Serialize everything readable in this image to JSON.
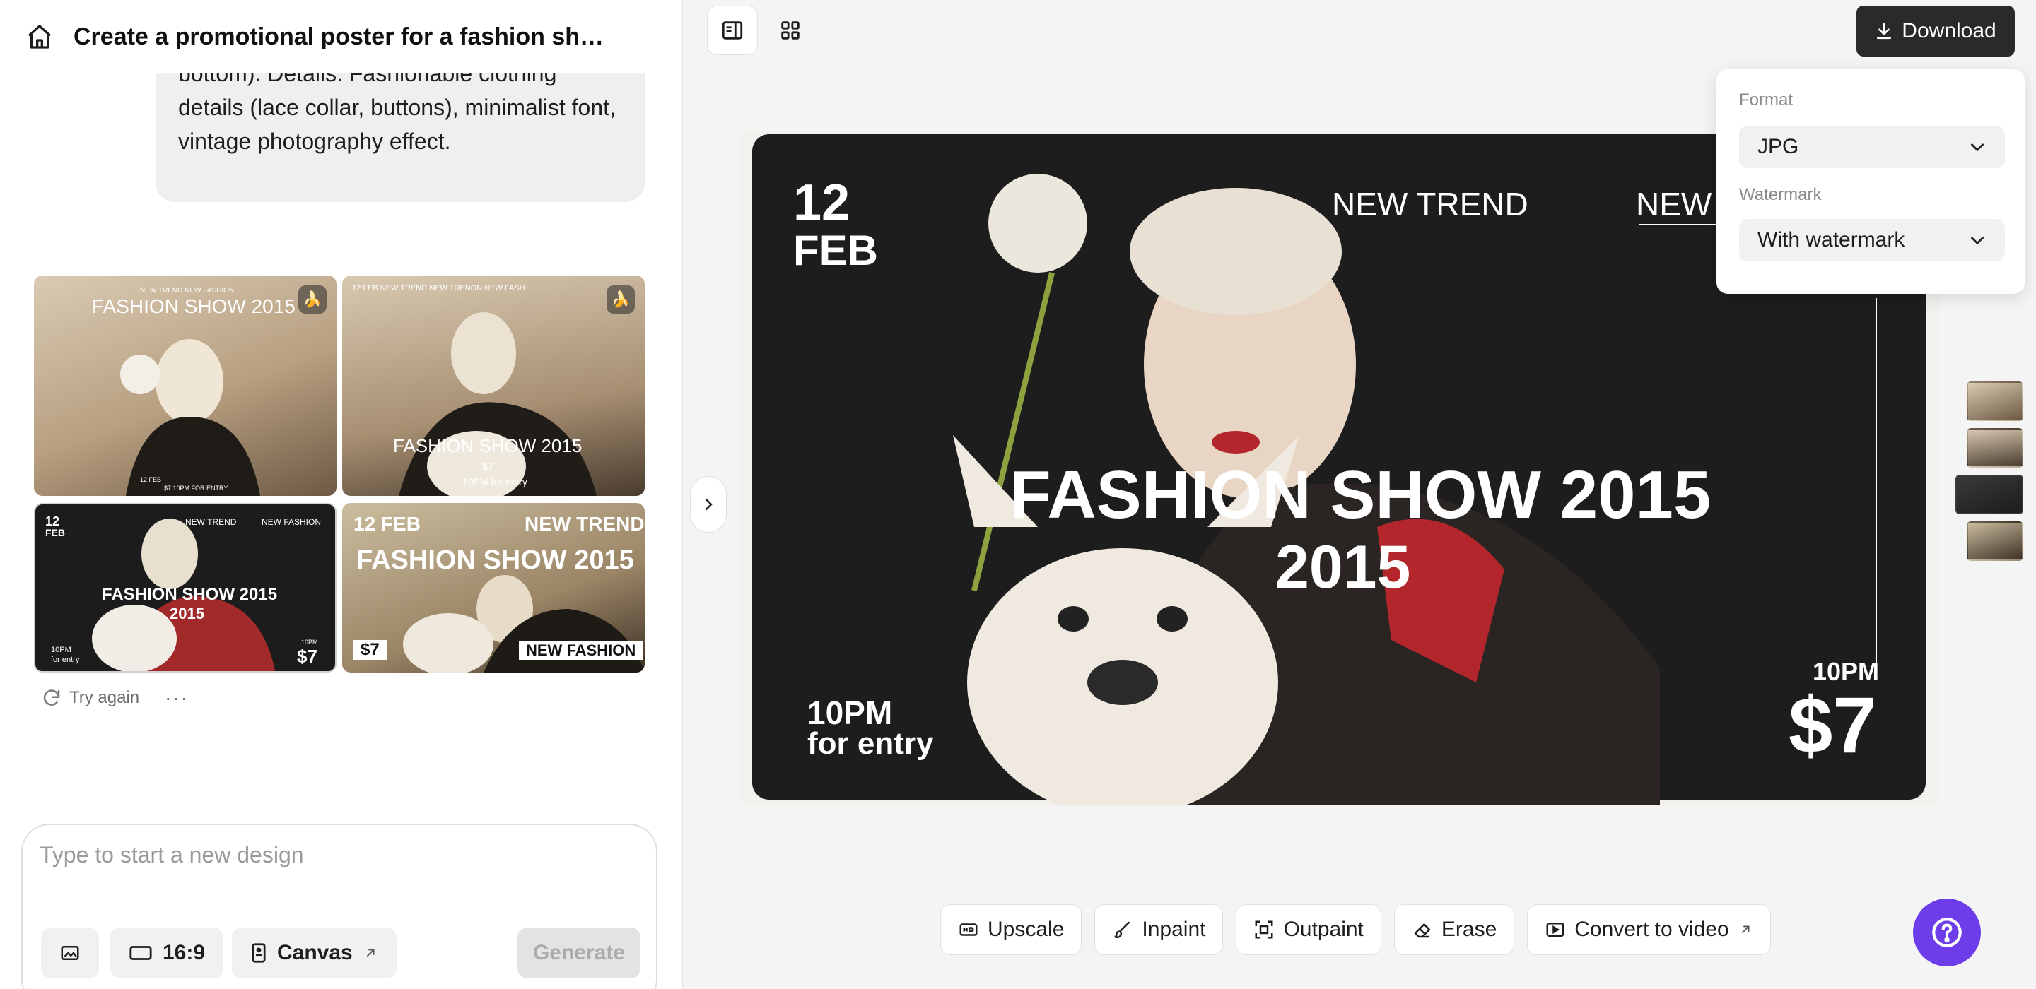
{
  "header": {
    "title": "Create a promotional poster for a fashion sh…"
  },
  "message": {
    "text": "the top, title in the middle, details at the bottom). Details: Fashionable clothing details (lace collar, buttons), minimalist font, vintage photography effect."
  },
  "results": {
    "thumbs": [
      {
        "title": "FASHION SHOW 2015",
        "top_small": "NEW TREND    NEW FASHION",
        "bottom": "$7    10PM FOR ENTRY",
        "date": "12 FEB"
      },
      {
        "title": "FASHION SHOW 2015",
        "top_small": "12 FEB    NEW TREND    NEW TRENON    NEW FASH",
        "price": "$7",
        "bottom": "10PM for entry"
      },
      {
        "date_num": "12",
        "date_mon": "FEB",
        "trend": "NEW TREND",
        "fashion": "NEW FASHION",
        "title1": "FASHION SHOW 2015",
        "title2": "2015",
        "time": "10PM",
        "entry": "for entry",
        "price_time": "10PM",
        "price": "$7"
      },
      {
        "date": "12 FEB",
        "trend": "NEW TREND",
        "title": "FASHION SHOW 2015",
        "price": "$7",
        "fashion": "NEW FASHION"
      }
    ],
    "try_again": "Try again",
    "more": "···"
  },
  "composer": {
    "placeholder": "Type to start a new design",
    "ratio": "16:9",
    "canvas": "Canvas",
    "generate": "Generate"
  },
  "toolbar": {
    "download": "Download"
  },
  "download_panel": {
    "format_label": "Format",
    "format_value": "JPG",
    "watermark_label": "Watermark",
    "watermark_value": "With watermark"
  },
  "poster": {
    "date_num": "12",
    "date_mon": "FEB",
    "trend1": "NEW TREND",
    "trend2": "NEW",
    "title_line1": "FASHION SHOW  2015",
    "title_line2": "2015",
    "time_left": "10PM",
    "entry_left": "for entry",
    "time_right": "10PM",
    "price": "$7"
  },
  "tools": {
    "upscale": "Upscale",
    "inpaint": "Inpaint",
    "outpaint": "Outpaint",
    "erase": "Erase",
    "convert": "Convert to video"
  },
  "colors": {
    "accent": "#6c3de8",
    "dark": "#2a2a2a",
    "poster_bg": "#1d1d1d",
    "red": "#b3262b"
  }
}
